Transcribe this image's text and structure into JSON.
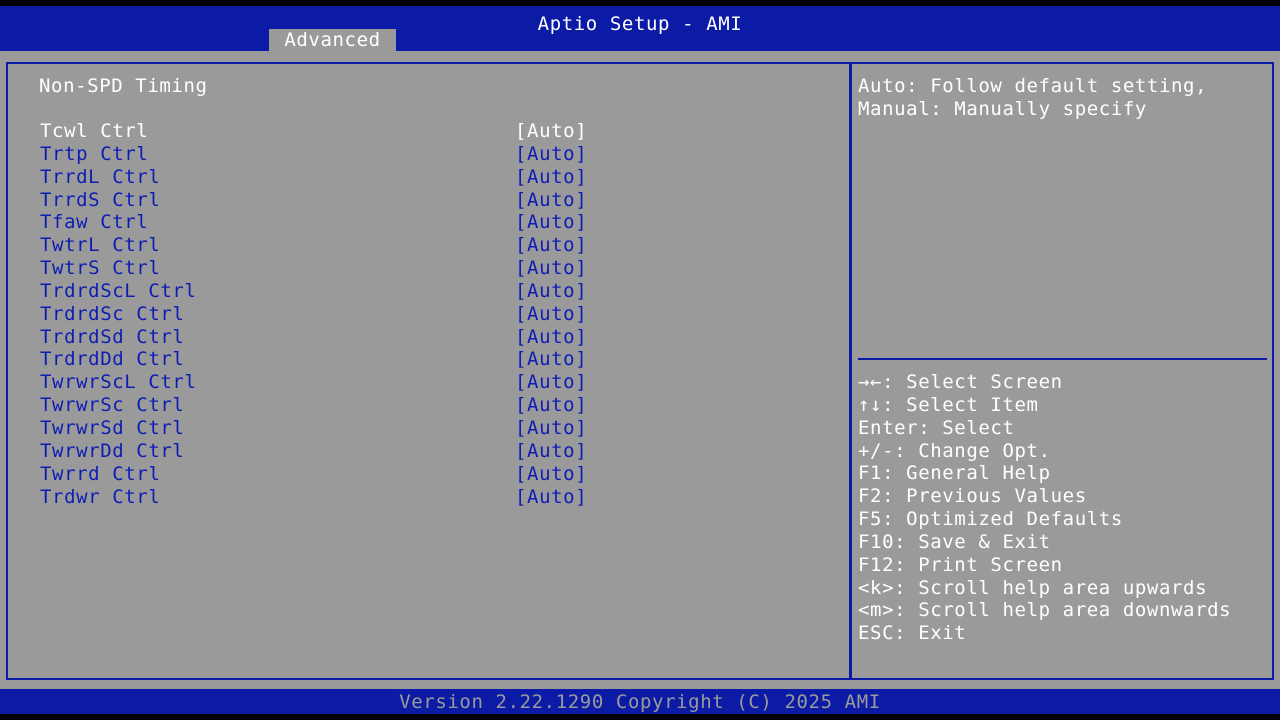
{
  "header": {
    "title": "Aptio Setup - AMI",
    "active_tab": "Advanced"
  },
  "main": {
    "section_title": "Non-SPD Timing",
    "settings": [
      {
        "label": "Tcwl Ctrl",
        "value": "[Auto]"
      },
      {
        "label": "Trtp Ctrl",
        "value": "[Auto]"
      },
      {
        "label": "TrrdL Ctrl",
        "value": "[Auto]"
      },
      {
        "label": "TrrdS Ctrl",
        "value": "[Auto]"
      },
      {
        "label": "Tfaw Ctrl",
        "value": "[Auto]"
      },
      {
        "label": "TwtrL Ctrl",
        "value": "[Auto]"
      },
      {
        "label": "TwtrS Ctrl",
        "value": "[Auto]"
      },
      {
        "label": "TrdrdScL Ctrl",
        "value": "[Auto]"
      },
      {
        "label": "TrdrdSc Ctrl",
        "value": "[Auto]"
      },
      {
        "label": "TrdrdSd Ctrl",
        "value": "[Auto]"
      },
      {
        "label": "TrdrdDd Ctrl",
        "value": "[Auto]"
      },
      {
        "label": "TwrwrScL Ctrl",
        "value": "[Auto]"
      },
      {
        "label": "TwrwrSc Ctrl",
        "value": "[Auto]"
      },
      {
        "label": "TwrwrSd Ctrl",
        "value": "[Auto]"
      },
      {
        "label": "TwrwrDd Ctrl",
        "value": "[Auto]"
      },
      {
        "label": "Twrrd Ctrl",
        "value": "[Auto]"
      },
      {
        "label": "Trdwr Ctrl",
        "value": "[Auto]"
      }
    ]
  },
  "help": {
    "description": [
      "Auto: Follow default setting,",
      "Manual: Manually specify"
    ],
    "keys": [
      "→←: Select Screen",
      "↑↓: Select Item",
      "Enter: Select",
      "+/-: Change Opt.",
      "F1: General Help",
      "F2: Previous Values",
      "F5: Optimized Defaults",
      "F10: Save & Exit",
      "F12: Print Screen",
      "<k>: Scroll help area upwards",
      "<m>: Scroll help area downwards",
      "ESC: Exit"
    ]
  },
  "footer": {
    "version": "Version 2.22.1290 Copyright (C) 2025 AMI"
  },
  "colors": {
    "bios_blue": "#0b1ba5",
    "panel_gray": "#9a9a9a",
    "text_white": "#ffffff",
    "item_blue": "#0d1db4"
  }
}
